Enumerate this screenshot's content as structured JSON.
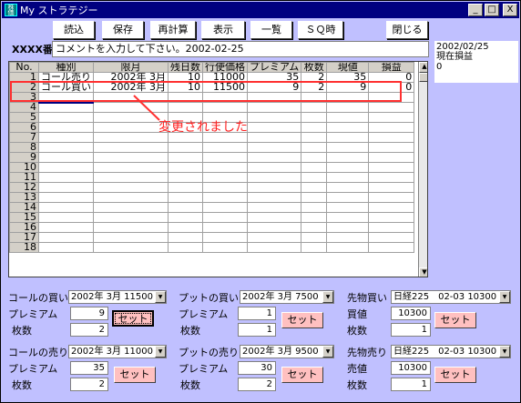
{
  "window": {
    "title": "My ストラテジー",
    "app_icon": "株価",
    "btn_min": "_",
    "btn_max": "□",
    "btn_close": "X"
  },
  "toolbar": {
    "read": "読込",
    "save": "保存",
    "recalc": "再計算",
    "display": "表示",
    "list": "一覧",
    "sq": "ＳＱ時",
    "close": "閉じる"
  },
  "code_label": "XXXX番",
  "comment": "コメントを入力して下さい。2002-02-25",
  "side_panel": {
    "date": "2002/02/25",
    "label": "現在損益",
    "value": "0"
  },
  "grid": {
    "headers": [
      "No.",
      "種別",
      "限月",
      "残日数",
      "行使価格",
      "プレミアム",
      "枚数",
      "現値",
      "損益"
    ],
    "rows": [
      [
        "1",
        "コール売り",
        "2002年 3月",
        "10",
        "11000",
        "35",
        "2",
        "35",
        "0"
      ],
      [
        "2",
        "コール買い",
        "2002年 3月",
        "10",
        "11500",
        "9",
        "2",
        "9",
        "0"
      ],
      [
        "3",
        "",
        "",
        "",
        "",
        "",
        "",
        "",
        ""
      ],
      [
        "4",
        "",
        "",
        "",
        "",
        "",
        "",
        "",
        ""
      ],
      [
        "5",
        "",
        "",
        "",
        "",
        "",
        "",
        "",
        ""
      ],
      [
        "6",
        "",
        "",
        "",
        "",
        "",
        "",
        "",
        ""
      ],
      [
        "7",
        "",
        "",
        "",
        "",
        "",
        "",
        "",
        ""
      ],
      [
        "8",
        "",
        "",
        "",
        "",
        "",
        "",
        "",
        ""
      ],
      [
        "9",
        "",
        "",
        "",
        "",
        "",
        "",
        "",
        ""
      ],
      [
        "10",
        "",
        "",
        "",
        "",
        "",
        "",
        "",
        ""
      ],
      [
        "11",
        "",
        "",
        "",
        "",
        "",
        "",
        "",
        ""
      ],
      [
        "12",
        "",
        "",
        "",
        "",
        "",
        "",
        "",
        ""
      ],
      [
        "13",
        "",
        "",
        "",
        "",
        "",
        "",
        "",
        ""
      ],
      [
        "14",
        "",
        "",
        "",
        "",
        "",
        "",
        "",
        ""
      ],
      [
        "15",
        "",
        "",
        "",
        "",
        "",
        "",
        "",
        ""
      ],
      [
        "16",
        "",
        "",
        "",
        "",
        "",
        "",
        "",
        ""
      ],
      [
        "17",
        "",
        "",
        "",
        "",
        "",
        "",
        "",
        ""
      ],
      [
        "18",
        "",
        "",
        "",
        "",
        "",
        "",
        "",
        ""
      ]
    ],
    "scroll_up": "▲",
    "scroll_down": "▼"
  },
  "annotation": "変更されました",
  "call_buy": {
    "label": "コールの買い",
    "select": "2002年 3月 11500",
    "premium_label": "プレミアム",
    "premium": "9",
    "qty_label": "枚数",
    "qty": "2",
    "set": "セット"
  },
  "put_buy": {
    "label": "プットの買い",
    "select": "2002年 3月 7500",
    "premium_label": "プレミアム",
    "premium": "1",
    "qty_label": "枚数",
    "qty": "1",
    "set": "セット"
  },
  "fut_buy": {
    "label": "先物買い",
    "select": "日経225　02-03 10300",
    "price_label": "買値",
    "price": "10300",
    "qty_label": "枚数",
    "qty": "1",
    "set": "セット"
  },
  "call_sell": {
    "label": "コールの売り",
    "select": "2002年 3月 11000",
    "premium_label": "プレミアム",
    "premium": "35",
    "qty_label": "枚数",
    "qty": "2",
    "set": "セット"
  },
  "put_sell": {
    "label": "プットの売り",
    "select": "2002年 3月 9500",
    "premium_label": "プレミアム",
    "premium": "30",
    "qty_label": "枚数",
    "qty": "2",
    "set": "セット"
  },
  "fut_sell": {
    "label": "先物売り",
    "select": "日経225　02-03 10300",
    "price_label": "売値",
    "price": "10300",
    "qty_label": "枚数",
    "qty": "1",
    "set": "セット"
  },
  "combo_arrow": "▼"
}
